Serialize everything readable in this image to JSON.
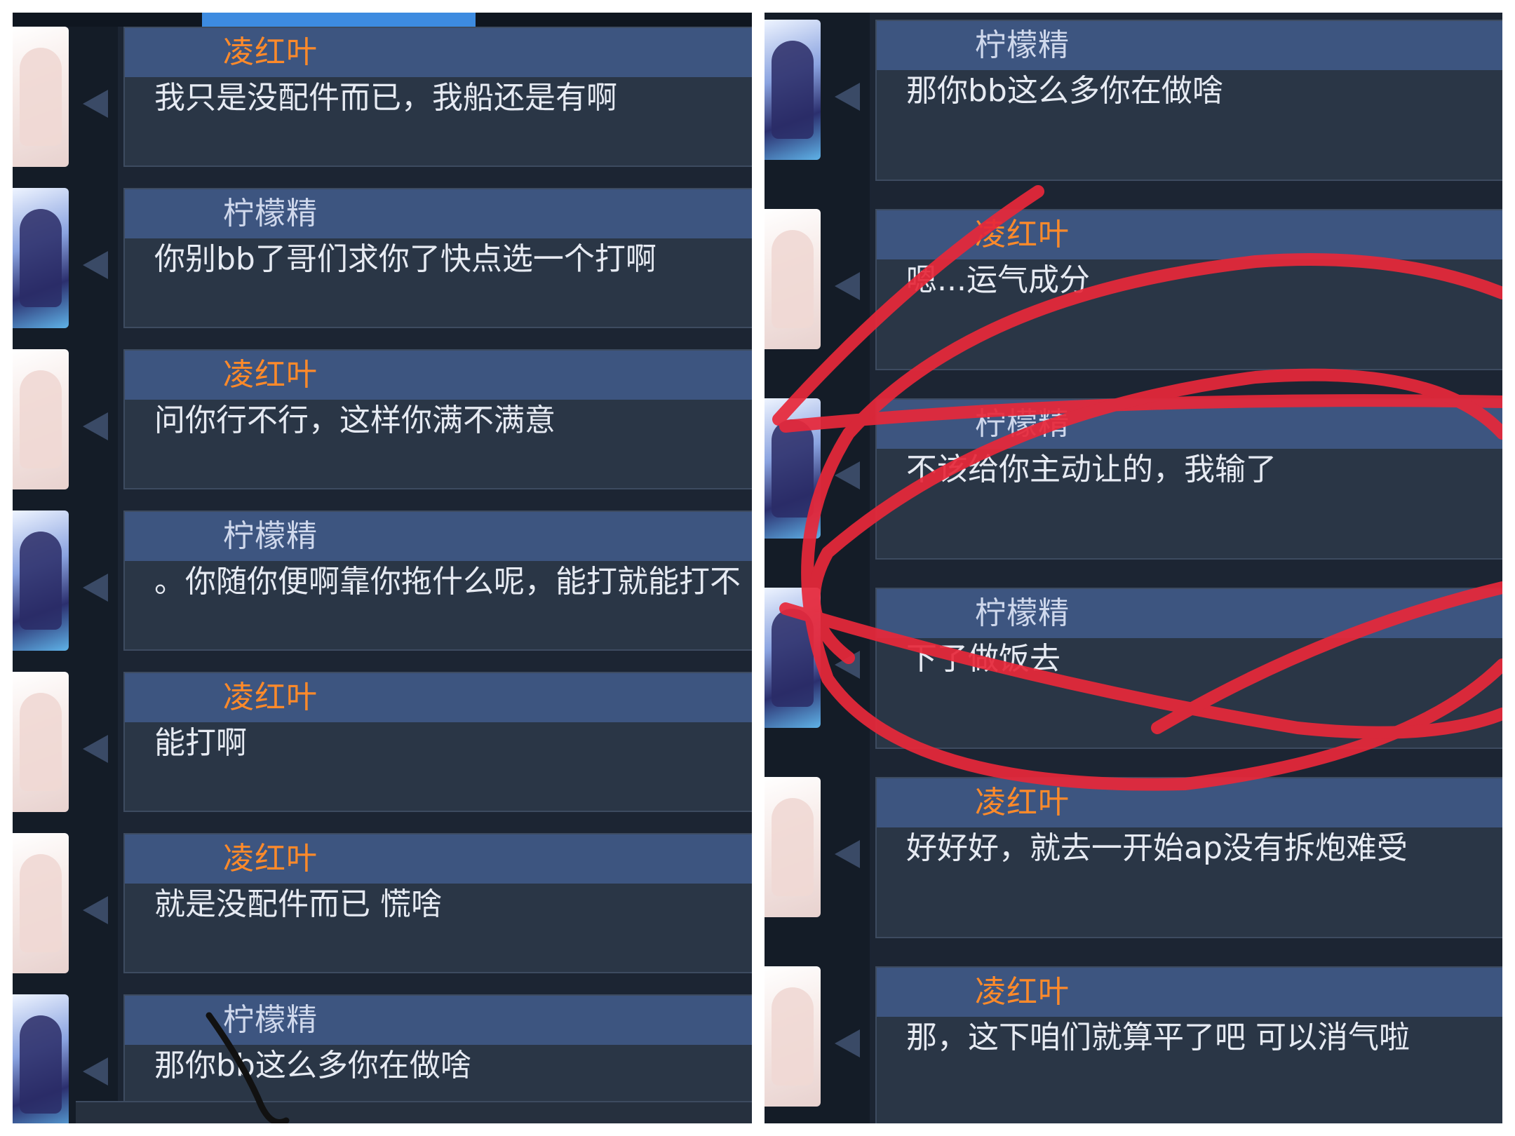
{
  "senders": {
    "lhy": "凌红叶",
    "nmj": "柠檬精"
  },
  "left": {
    "messages": [
      {
        "name": "凌红叶",
        "text": "我只是没配件而已，我船还是有啊"
      },
      {
        "name": "柠檬精",
        "text": "你别bb了哥们求你了快点选一个打啊"
      },
      {
        "name": "凌红叶",
        "text": "问你行不行，这样你满不满意"
      },
      {
        "name": "柠檬精",
        "text": "。你随你便啊靠你拖什么呢，能打就能打不"
      },
      {
        "name": "凌红叶",
        "text": "能打啊"
      },
      {
        "name": "凌红叶",
        "text": "就是没配件而已 慌啥"
      },
      {
        "name": "柠檬精",
        "text": "那你bb这么多你在做啥"
      }
    ]
  },
  "right": {
    "messages": [
      {
        "name": "柠檬精",
        "text": "那你bb这么多你在做啥"
      },
      {
        "name": "凌红叶",
        "text": "嗯...运气成分"
      },
      {
        "name": "柠檬精",
        "text": "不该给你主动让的，我输了"
      },
      {
        "name": "柠檬精",
        "text": "下了做饭去"
      },
      {
        "name": "凌红叶",
        "text": "好好好，就去一开始ap没有拆炮难受"
      },
      {
        "name": "凌红叶",
        "text": "那，这下咱们就算平了吧 可以消气啦"
      }
    ]
  },
  "colors": {
    "name_lhy": "#ff8a2a",
    "name_nmj": "#cfd8ec",
    "scribble_red": "#e8283a",
    "scribble_black": "#111111"
  }
}
